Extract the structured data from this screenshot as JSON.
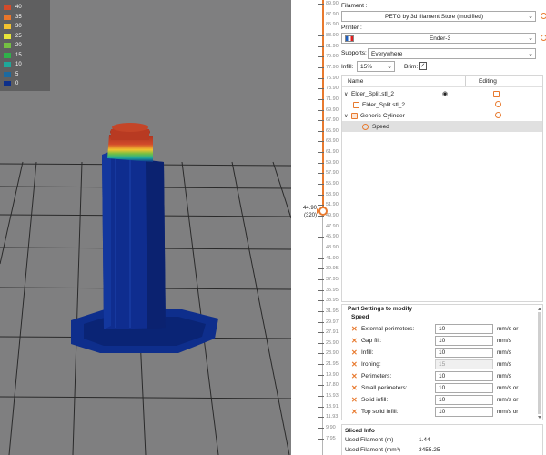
{
  "legend": {
    "items": [
      {
        "label": "40",
        "color": "#d24b2a"
      },
      {
        "label": "35",
        "color": "#e8762c"
      },
      {
        "label": "30",
        "color": "#f2c230"
      },
      {
        "label": "25",
        "color": "#e8e53a"
      },
      {
        "label": "20",
        "color": "#74c043"
      },
      {
        "label": "15",
        "color": "#2fb14a"
      },
      {
        "label": "10",
        "color": "#1fa89a"
      },
      {
        "label": "5",
        "color": "#1c6aa0"
      },
      {
        "label": "0",
        "color": "#0d2f8a"
      }
    ]
  },
  "slider": {
    "ticks": [
      "89.90",
      "87.90",
      "85.90",
      "83.90",
      "81.90",
      "79.90",
      "77.90",
      "75.90",
      "73.90",
      "71.90",
      "69.90",
      "67.90",
      "65.90",
      "63.90",
      "61.90",
      "59.90",
      "57.90",
      "55.90",
      "53.90",
      "51.90",
      "49.90",
      "47.90",
      "45.90",
      "43.90",
      "41.90",
      "39.95",
      "37.95",
      "35.95",
      "33.95",
      "31.95",
      "29.97",
      "27.91",
      "25.90",
      "23.90",
      "21.95",
      "19.90",
      "17.80",
      "15.93",
      "13.91",
      "11.93",
      "9.90",
      "7.95"
    ],
    "readout_value": "44.90",
    "readout_layer": "(320)"
  },
  "panel": {
    "filament_label": "Filament :",
    "filament_value": "PETG by 3d filament Store (modified)",
    "printer_label": "Printer :",
    "printer_value": "Ender-3",
    "supports_label": "Supports:",
    "supports_value": "Everywhere",
    "infill_label": "Infill:",
    "infill_value": "15%",
    "brim_label": "Brim:",
    "brim_checked": "✓",
    "tree": {
      "col_name": "Name",
      "col_editing": "Editing",
      "rows": [
        {
          "label": "Elder_Split.stl_2"
        },
        {
          "label": "Elder_Split.stl_2"
        },
        {
          "label": "Generic-Cylinder"
        },
        {
          "label": "Speed"
        }
      ],
      "expand_glyph": "∨",
      "eye_glyph": "◉"
    },
    "part_settings": {
      "title": "Part Settings to modify",
      "group": "Speed",
      "rows": [
        {
          "label": "External perimeters:",
          "value": "10",
          "unit": "mm/s or",
          "disabled": false
        },
        {
          "label": "Gap fill:",
          "value": "10",
          "unit": "mm/s",
          "disabled": false
        },
        {
          "label": "Infill:",
          "value": "10",
          "unit": "mm/s",
          "disabled": false
        },
        {
          "label": "Ironing:",
          "value": "15",
          "unit": "mm/s",
          "disabled": true
        },
        {
          "label": "Perimeters:",
          "value": "10",
          "unit": "mm/s",
          "disabled": false
        },
        {
          "label": "Small perimeters:",
          "value": "10",
          "unit": "mm/s or",
          "disabled": false
        },
        {
          "label": "Solid infill:",
          "value": "10",
          "unit": "mm/s or",
          "disabled": false
        },
        {
          "label": "Top solid infill:",
          "value": "10",
          "unit": "mm/s or",
          "disabled": false
        }
      ],
      "remove_glyph": "✕"
    },
    "sliced_info": {
      "title": "Sliced Info",
      "rows": [
        {
          "label": "Used Filament (m)",
          "value": "1.44"
        },
        {
          "label": "Used Filament (mm³)",
          "value": "3455.25"
        }
      ]
    }
  }
}
